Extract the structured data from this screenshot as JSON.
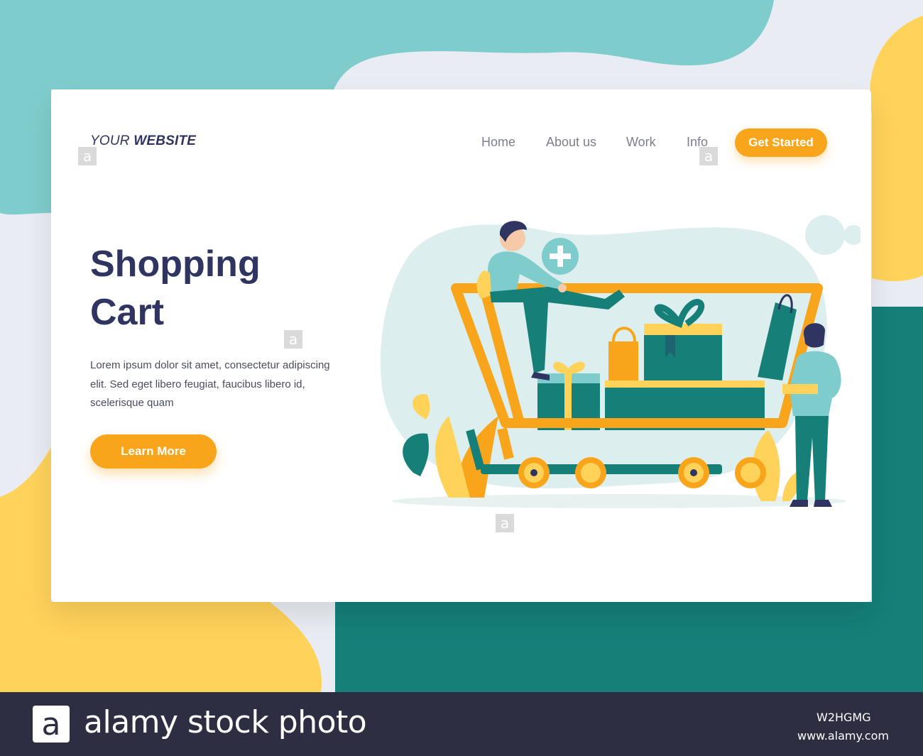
{
  "header": {
    "logo_prefix": "YOUR",
    "logo_suffix": "WEBSITE",
    "nav": [
      {
        "label": "Home"
      },
      {
        "label": "About us"
      },
      {
        "label": "Work"
      },
      {
        "label": "Info"
      }
    ],
    "cta_label": "Get Started"
  },
  "hero": {
    "title_line1": "Shopping",
    "title_line2": "Cart",
    "body": "Lorem ipsum dolor sit amet, consectetur adipiscing elit. Sed eget libero feugiat, faucibus libero id, scelerisque quam",
    "cta_label": "Learn More"
  },
  "illustration": {
    "icon": "plus-icon",
    "subject": "shopping-cart-illustration"
  },
  "footer": {
    "logo_letter": "a",
    "brand": "alamy stock photo",
    "image_code": "W2HGMG",
    "url": "www.alamy.com"
  },
  "colors": {
    "navy": "#2f3460",
    "orange": "#f9a51b",
    "teal": "#157f78",
    "mint": "#7ecdcc",
    "yellow": "#ffd25a",
    "footer_bg": "#2e2e42"
  }
}
